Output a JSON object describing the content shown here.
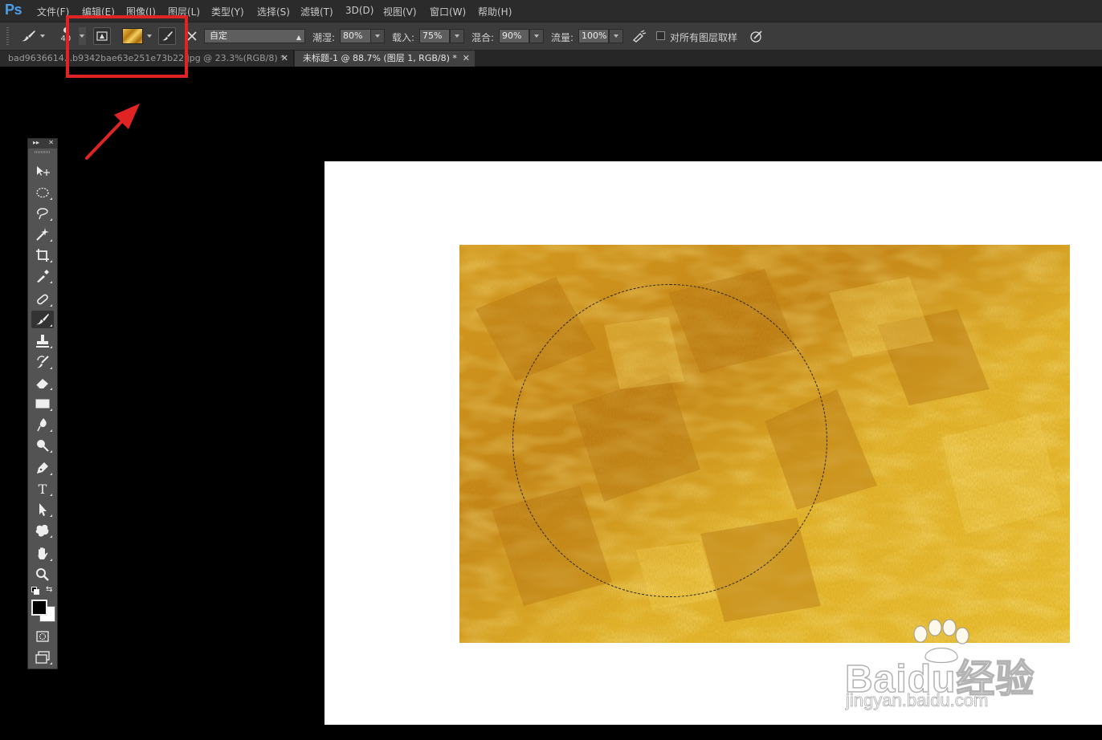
{
  "app": {
    "logo": "Ps"
  },
  "menu": [
    "文件(F)",
    "编辑(E)",
    "图像(I)",
    "图层(L)",
    "类型(Y)",
    "选择(S)",
    "滤镜(T)",
    "3D(D)",
    "视图(V)",
    "窗口(W)",
    "帮助(H)"
  ],
  "options": {
    "brush_size": "40",
    "preset": "自定",
    "wet_label": "潮湿:",
    "wet_value": "80%",
    "load_label": "载入:",
    "load_value": "75%",
    "mix_label": "混合:",
    "mix_value": "90%",
    "flow_label": "流量:",
    "flow_value": "100%",
    "sample_all_label": "对所有图层取样",
    "sample_all_checked": false
  },
  "tabs": [
    {
      "label": "bad9636614...b9342bae63e251e73b22.jpg @ 23.3%(RGB/8) *",
      "active": false
    },
    {
      "label": "未标题-1 @ 88.7% (图层 1, RGB/8) *",
      "active": true
    }
  ],
  "tools": [
    "move-tool",
    "elliptical-marquee-tool",
    "lasso-tool",
    "magic-wand-tool",
    "crop-tool",
    "eyedropper-tool",
    "spot-healing-tool",
    "mixer-brush-tool",
    "clone-stamp-tool",
    "history-brush-tool",
    "eraser-tool",
    "gradient-tool",
    "blur-tool",
    "dodge-tool",
    "pen-tool",
    "type-tool",
    "path-selection-tool",
    "custom-shape-tool",
    "hand-tool",
    "zoom-tool"
  ],
  "type_tool_glyph": "T",
  "colors": {
    "foreground": "#000000",
    "background": "#ffffff",
    "highlight": "#e02424",
    "accent": "#4a9ee8",
    "gold": "#d9a21a"
  },
  "watermark": {
    "brand": "Baidu经验",
    "url": "jingyan.baidu.com"
  }
}
